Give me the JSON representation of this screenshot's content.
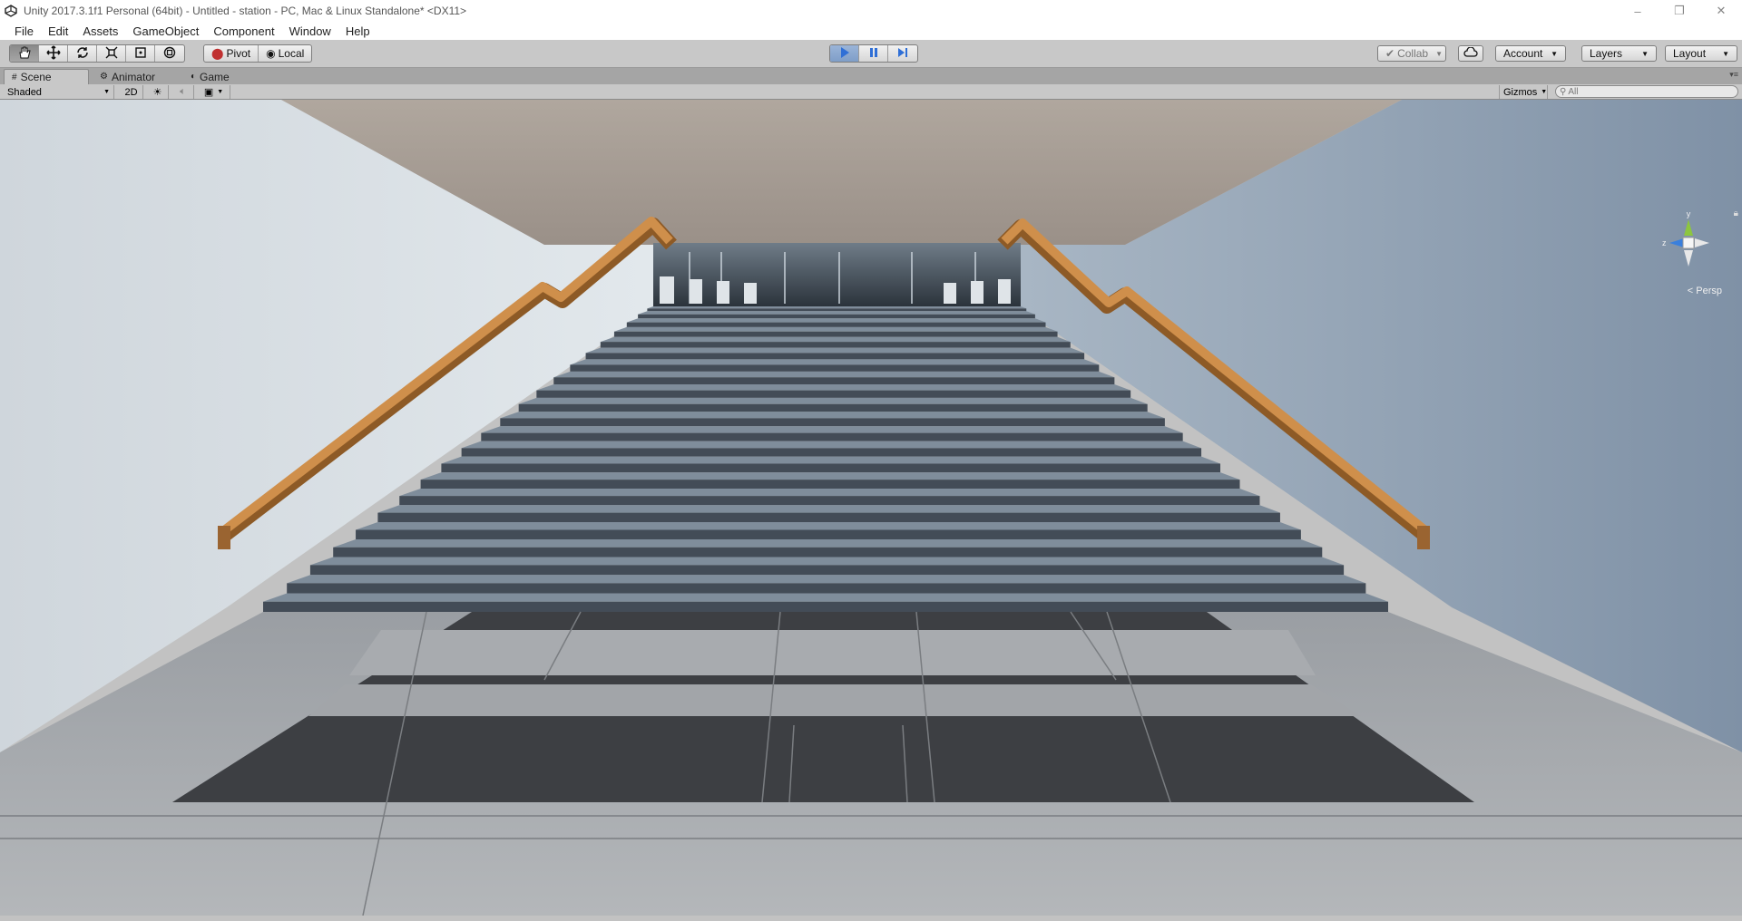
{
  "window": {
    "title": "Unity 2017.3.1f1 Personal (64bit) - Untitled - station - PC, Mac & Linux Standalone* <DX11>",
    "controls": {
      "minimize": "–",
      "restore": "❐",
      "close": "✕"
    }
  },
  "menu": [
    "File",
    "Edit",
    "Assets",
    "GameObject",
    "Component",
    "Window",
    "Help"
  ],
  "toolbar": {
    "transform_tools": [
      "hand-icon",
      "move-icon",
      "rotate-icon",
      "scale-icon",
      "rect-tool-icon",
      "transform-icon"
    ],
    "active_tool": "hand-icon",
    "pivot_label": "Pivot",
    "local_label": "Local",
    "play_controls": [
      "play-icon",
      "pause-icon",
      "step-icon"
    ],
    "collab_label": "Collab",
    "account_label": "Account",
    "layers_label": "Layers",
    "layout_label": "Layout"
  },
  "tabs": [
    {
      "label": "Scene",
      "icon": "#",
      "active": true
    },
    {
      "label": "Animator",
      "icon": "⚙",
      "active": false
    },
    {
      "label": "Game",
      "icon": "◐",
      "active": false
    }
  ],
  "scene_toolbar": {
    "draw_mode": "Shaded",
    "mode_2d": "2D",
    "gizmos_label": "Gizmos",
    "search_placeholder": "All"
  },
  "scene_gizmo": {
    "y_label": "y",
    "z_label": "z",
    "projection": "Persp"
  },
  "colors": {
    "play_accent": "#2f6fd6",
    "railing": "#c98a45",
    "stairs": "#4a5461",
    "ceiling": "#a49a90",
    "wall_left": "#d6dde3",
    "wall_right": "#8e9fb2"
  }
}
